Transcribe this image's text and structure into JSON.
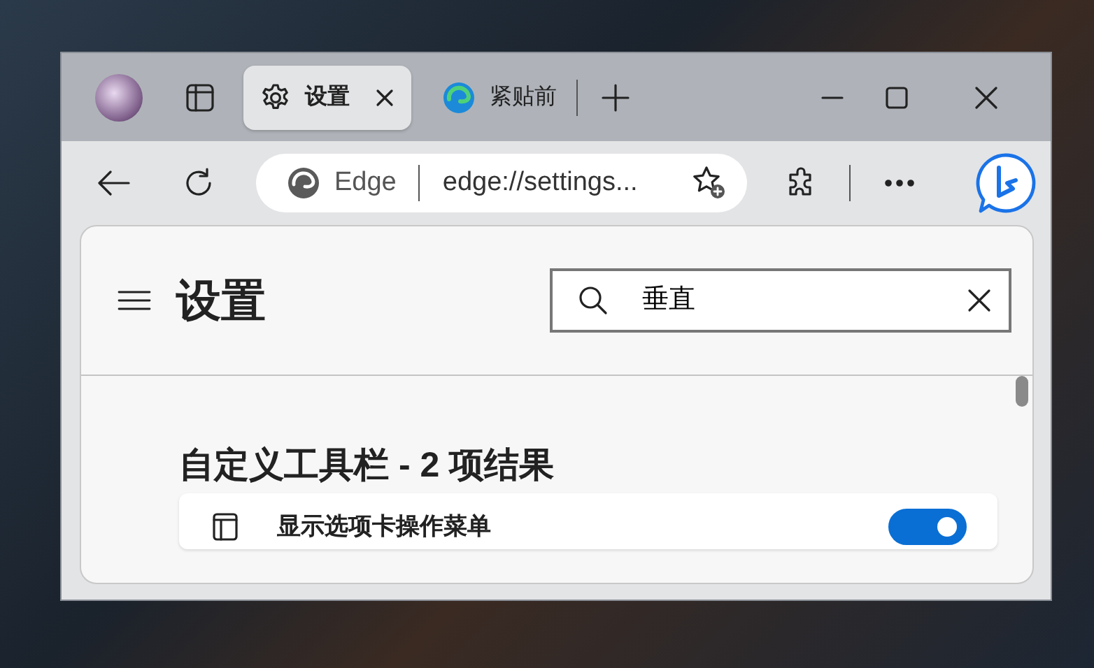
{
  "tabs": [
    {
      "title": "设置",
      "kind": "settings",
      "selected": true
    },
    {
      "title": "紧贴前",
      "kind": "web",
      "selected": false
    }
  ],
  "address_bar": {
    "site_label": "Edge",
    "url": "edge://settings..."
  },
  "settings": {
    "title": "设置",
    "search": {
      "value": "垂直"
    },
    "section_title": "自定义工具栏 - 2 项结果",
    "results": [
      {
        "label": "显示选项卡操作菜单",
        "on": true
      }
    ]
  }
}
